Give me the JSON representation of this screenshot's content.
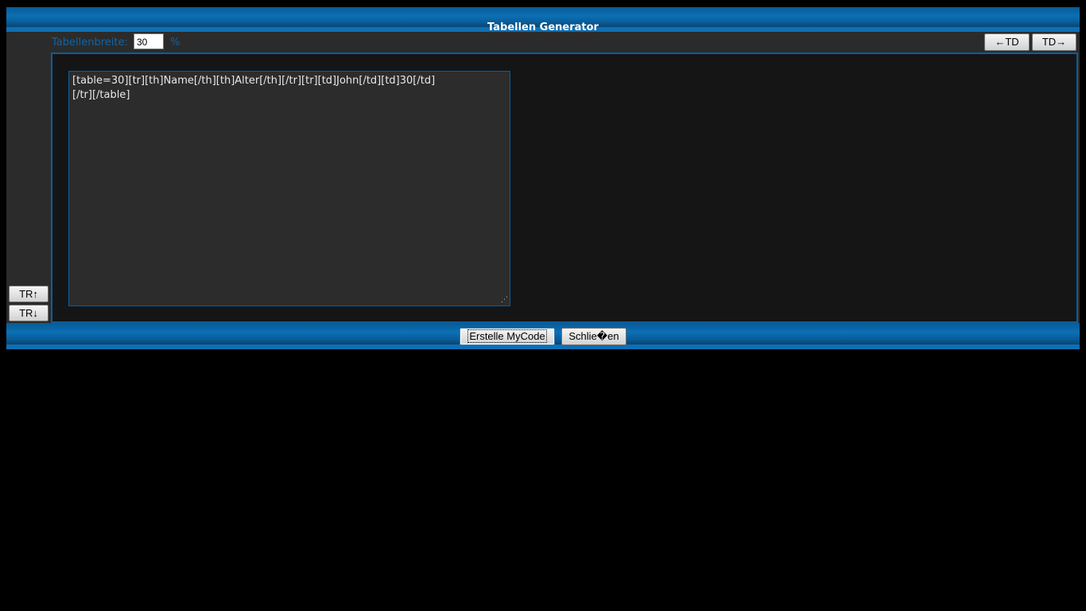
{
  "dialog": {
    "title": "Tabellen Generator",
    "width_label": "Tabellenbreite:",
    "width_value": "30",
    "width_unit": "%"
  },
  "toolbar": {
    "td_left_label": "←TD",
    "td_right_label": "TD→",
    "tr_up_label": "TR↑",
    "tr_down_label": "TR↓"
  },
  "editor": {
    "code": "[table=30][tr][th]Name[/th][th]Alter[/th][/tr][tr][td]John[/td][td]30[/td]\n[/tr][/table]"
  },
  "footer": {
    "create_label": "Erstelle MyCode",
    "close_label": "Schlie�en"
  },
  "colors": {
    "accent": "#0b70b5",
    "background": "#000000",
    "panel": "#2b2b2b",
    "work_area": "#151515",
    "label_blue": "#0e64a8"
  }
}
